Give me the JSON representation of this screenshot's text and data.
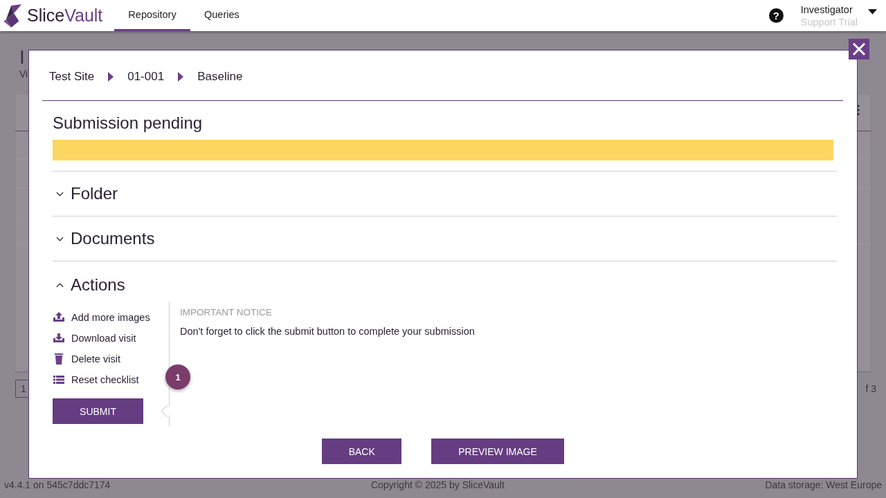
{
  "header": {
    "brand_first": "Slice",
    "brand_second": "Vault",
    "tabs": [
      {
        "label": "Repository",
        "selected": true
      },
      {
        "label": "Queries",
        "selected": false
      }
    ],
    "help_glyph": "?",
    "user": {
      "name": "Investigator",
      "role": "Support Trial"
    }
  },
  "background_page": {
    "title": "I",
    "subtitle": "Vi",
    "pager_page": "1",
    "pager_total": "f 3"
  },
  "modal": {
    "breadcrumb": [
      "Test Site",
      "01-001",
      "Baseline"
    ],
    "status_title": "Submission pending",
    "sections": [
      {
        "title": "Folder",
        "expanded": false
      },
      {
        "title": "Documents",
        "expanded": false
      },
      {
        "title": "Actions",
        "expanded": true
      }
    ],
    "actions": [
      {
        "label": "Add more images",
        "kind": "upload"
      },
      {
        "label": "Download visit",
        "kind": "download"
      },
      {
        "label": "Delete visit",
        "kind": "delete"
      },
      {
        "label": "Reset checklist",
        "kind": "list"
      }
    ],
    "submit": "SUBMIT",
    "step_badge": "1",
    "notice": {
      "heading": "IMPORTANT NOTICE",
      "text": "Don't forget to click the submit button to complete your submission"
    },
    "buttons": [
      "BACK",
      "PREVIEW IMAGE"
    ]
  },
  "footer": {
    "version": "v4.4.1 on 545c7ddc7174",
    "copyright": "Copyright © 2025 by SliceVault",
    "storage": "Data storage: West Europe"
  }
}
